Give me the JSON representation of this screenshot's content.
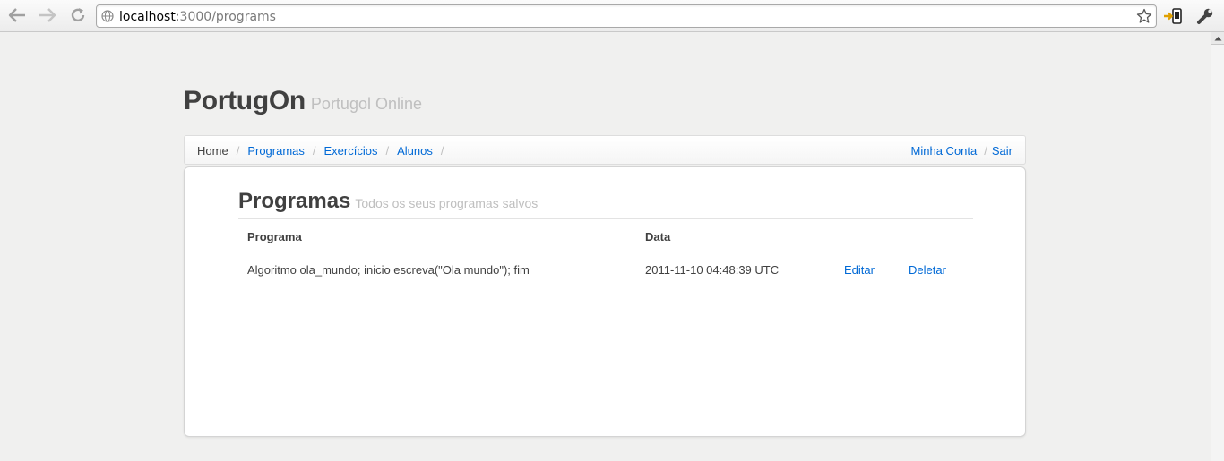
{
  "browser": {
    "url_host": "localhost",
    "url_path": ":3000/programs"
  },
  "brand": {
    "title": "PortugOn",
    "subtitle": "Portugol Online"
  },
  "breadcrumb": {
    "items": [
      {
        "label": "Home"
      },
      {
        "label": "Programas"
      },
      {
        "label": "Exercícios"
      },
      {
        "label": "Alunos"
      }
    ],
    "separator": "/",
    "account_label": "Minha Conta",
    "logout_label": "Sair"
  },
  "page": {
    "title": "Programas",
    "subtitle": "Todos os seus programas salvos"
  },
  "table": {
    "headers": [
      "Programa",
      "Data"
    ],
    "rows": [
      {
        "program": "Algoritmo ola_mundo; inicio escreva(\"Ola mundo\"); fim",
        "date": "2011-11-10 04:48:39 UTC",
        "edit": "Editar",
        "delete": "Deletar"
      }
    ]
  },
  "colors": {
    "link": "#0069d6",
    "heading": "#404040",
    "muted": "#bfbfbf",
    "background": "#f0f0ef"
  },
  "icons": [
    "back-icon",
    "forward-icon",
    "reload-icon",
    "globe-icon",
    "bookmark-star-icon",
    "extension-icon",
    "wrench-icon"
  ]
}
